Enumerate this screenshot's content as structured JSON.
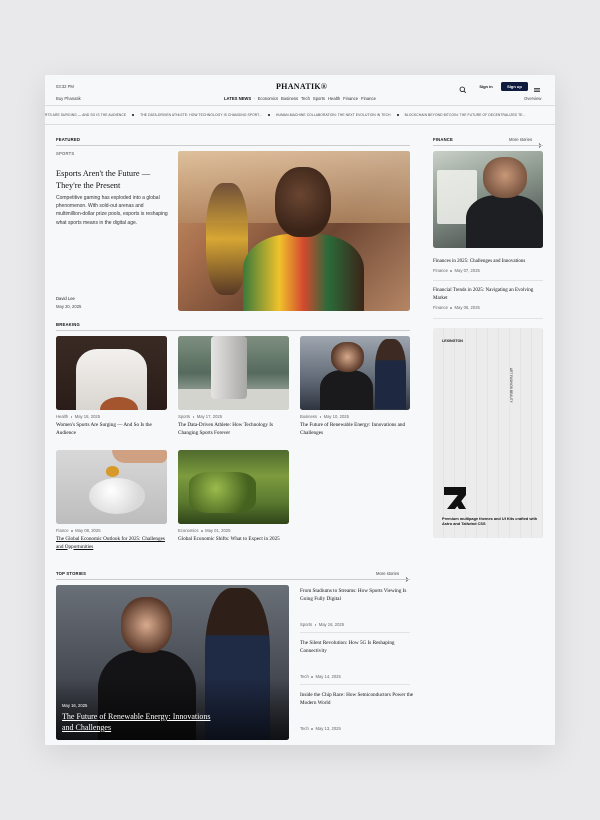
{
  "header": {
    "time": "03:32 PM",
    "logo": "PHANATIK®",
    "sub_left": "Buy Phanatik",
    "signin": "Sign in",
    "signup": "Sign up",
    "overview": "Overview",
    "nav": [
      "LATES NEWS",
      "Economics",
      "Business",
      "Tech",
      "Sports",
      "Health",
      "Finance",
      "Finance"
    ]
  },
  "ticker": [
    "RTS ARE SURGING — AND SO IS THE AUDIENCE",
    "THE DATA-DRIVEN ATHLETE: HOW TECHNOLOGY IS CHANGING SPORT...",
    "HUMAN-MACHINE COLLABORATION: THE NEXT EVOLUTION IN TECH",
    "BLOCKCHAIN BEYOND BITCOIN: THE FUTURE OF DECENTRALIZED TE..."
  ],
  "featured": {
    "label": "FEATURED",
    "category": "SPORTS",
    "title": "Esports Aren't the Future — They're the Present",
    "summary": "Competitive gaming has exploded into a global phenomenon. With sold-out arenas and multimillion-dollar prize pools, esports is reshaping what sports means in the digital age.",
    "author": "David Lee",
    "date": "May 20, 2025"
  },
  "finance": {
    "label": "FINANCE",
    "more": "More stories",
    "items": [
      {
        "title": "Finances in 2025: Challenges and Innovations",
        "category": "Finance",
        "date": "May 07, 2025"
      },
      {
        "title": "Financial Trends in 2025: Navigating an Evolving Market",
        "category": "Finance",
        "date": "May 06, 2025"
      }
    ]
  },
  "ad": {
    "brand": "LEXINGTON",
    "side_text": "ART FASHION BEAUTY",
    "tagline": "Premium multipage themes and UI Kits crafted with Astro and Tailwind CSS"
  },
  "breaking": {
    "label": "BREAKING",
    "cards": [
      {
        "category": "Health",
        "date": "May 18, 2025",
        "title": "Women's Sports Are Surging — And So Is the Audience"
      },
      {
        "category": "Sports",
        "date": "May 17, 2025",
        "title": "The Data-Driven Athlete: How Technology Is Changing Sports Forever"
      },
      {
        "category": "Business",
        "date": "May 10, 2025",
        "title": "The Future of Renewable Energy: Innovations and Challenges"
      },
      {
        "category": "Fiance",
        "date": "May 08, 2025",
        "title": "The Global Economic Outlook for 2025: Challenges and Opportunities"
      },
      {
        "category": "Economics",
        "date": "May 01, 2025",
        "title": "Global Economic Shifts: What to Expect in 2025"
      }
    ]
  },
  "top_stories": {
    "label": "TOP STORIES",
    "more": "More stories",
    "hero": {
      "date": "May 16, 2025",
      "title": "The Future of Renewable Energy: Innovations and Challenges"
    },
    "list": [
      {
        "title": "From Stadiums to Streams: How Sports Viewing Is Going Fully Digital",
        "category": "Sports",
        "date": "May 16, 2025"
      },
      {
        "title": "The Silent Revolution: How 5G Is Reshaping Connectivity",
        "category": "Tech",
        "date": "May 14, 2025"
      },
      {
        "title": "Inside the Chip Race: How Semiconductors Power the Modern World",
        "category": "Tech",
        "date": "May 13, 2025"
      }
    ]
  }
}
